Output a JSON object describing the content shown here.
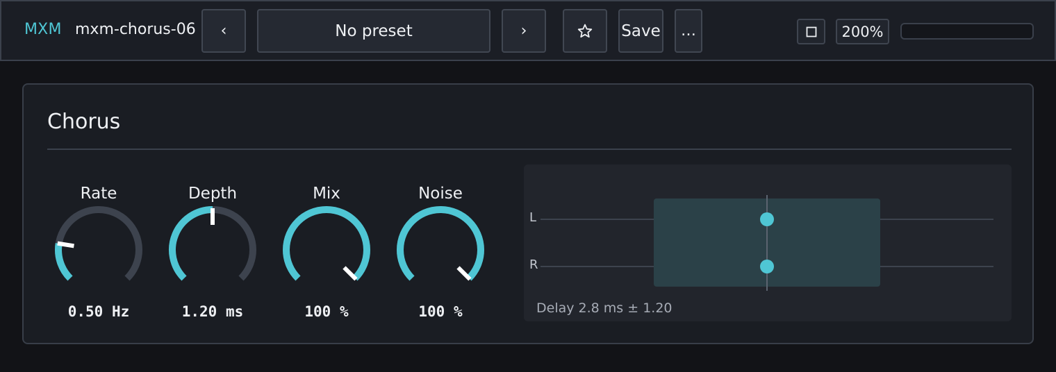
{
  "header": {
    "brand": "MXM",
    "plugin_name": "mxm-chorus-06",
    "prev_label": "‹",
    "preset_label": "No preset",
    "next_label": "›",
    "favorite_icon": "star-icon",
    "save_label": "Save",
    "more_label": "…",
    "window_icon": "window-icon",
    "zoom_label": "200%",
    "level_meter": 0
  },
  "panel": {
    "title": "Chorus",
    "knobs": [
      {
        "label": "Rate",
        "value": "0.50 Hz",
        "position": 0.2
      },
      {
        "label": "Depth",
        "value": "1.20 ms",
        "position": 0.5
      },
      {
        "label": "Mix",
        "value": "100 %",
        "position": 1.0
      },
      {
        "label": "Noise",
        "value": "100 %",
        "position": 1.0
      }
    ],
    "delay_view": {
      "left_label": "L",
      "right_label": "R",
      "caption": "Delay 2.8 ms ± 1.20"
    }
  },
  "colors": {
    "accent": "#4fc6d4",
    "track": "#3d434e",
    "pointer": "#ffffff",
    "background": "#121317",
    "panel": "#1a1d23"
  }
}
